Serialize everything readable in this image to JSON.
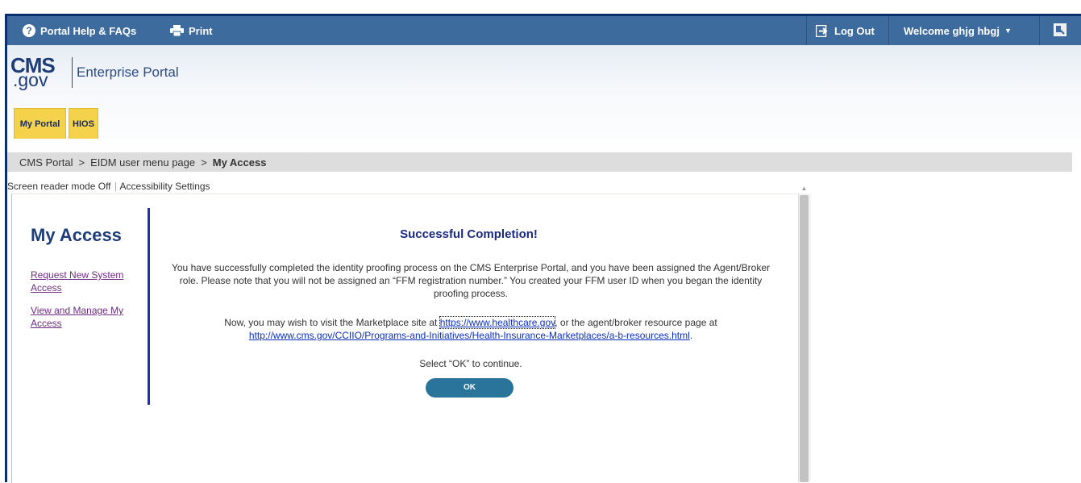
{
  "topbar": {
    "help_label": "Portal Help & FAQs",
    "print_label": "Print",
    "logout_label": "Log Out",
    "welcome_label": "Welcome ghjg hbgj"
  },
  "logo": {
    "cms": "CMS",
    "gov": ".gov",
    "portal": "Enterprise Portal"
  },
  "tabs": [
    "My Portal",
    "HIOS"
  ],
  "breadcrumb": [
    "CMS Portal",
    "EIDM user menu page",
    "My Access"
  ],
  "breadcrumb_sep": ">",
  "accessibility": {
    "screen_reader": "Screen reader mode Off",
    "settings": "Accessibility Settings"
  },
  "sidebar": {
    "title": "My Access",
    "links": [
      "Request New System Access",
      "View and Manage My Access"
    ]
  },
  "message": {
    "title": "Successful Completion!",
    "paragraph1": "You have successfully completed the identity proofing process on the CMS Enterprise Portal, and you have been assigned the Agent/Broker role. Please note that you will not be assigned an “FFM registration number.” You created your FFM user ID when you began the identity proofing process.",
    "p2_before": "Now, you may wish to visit the Marketplace site at ",
    "p2_link1": "https://www.healthcare.gov",
    "p2_middle": ", or the agent/broker resource page at",
    "p2_link2": "http://www.cms.gov/CCIIO/Programs-and-Initiatives/Health-Insurance-Marketplaces/a-b-resources.html",
    "p2_end": ".",
    "continue_text": "Select “OK” to continue.",
    "ok_label": "OK"
  },
  "colors": {
    "topbar": "#3d6b9e",
    "tab": "#f5d24b",
    "ok_button": "#2a749c",
    "sidebar_rule": "#1c2fb9"
  }
}
